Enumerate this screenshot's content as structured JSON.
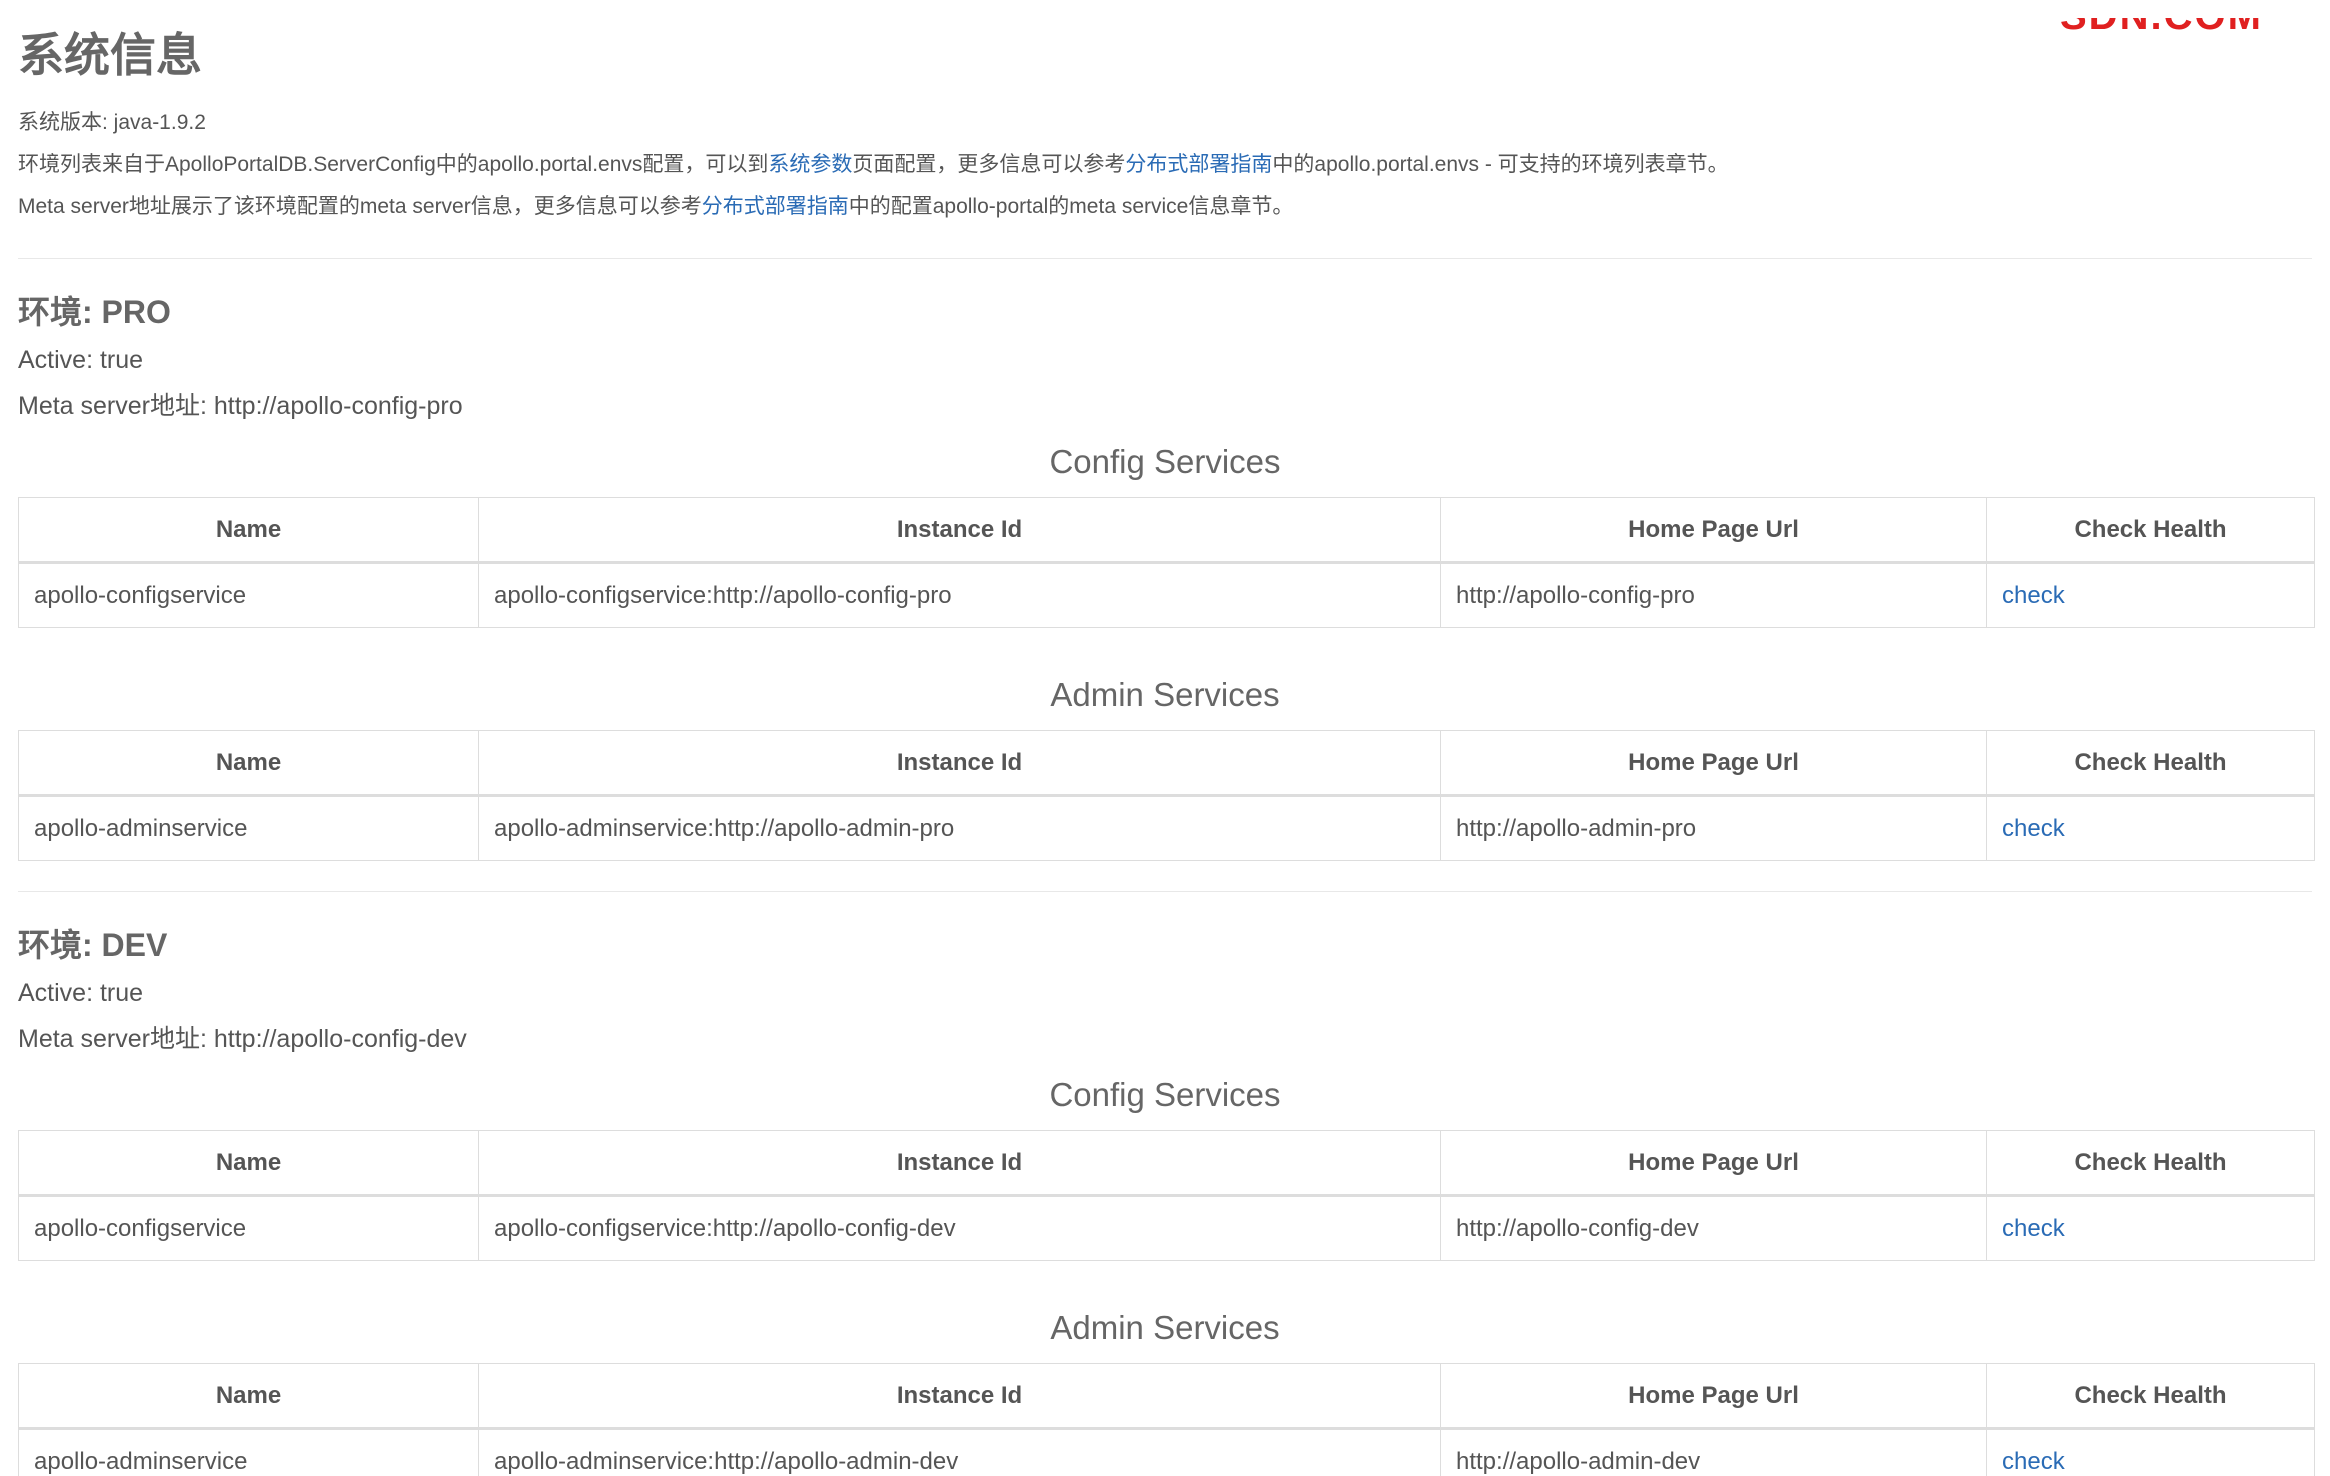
{
  "page": {
    "title": "系统信息",
    "version": "系统版本: java-1.9.2",
    "info1": {
      "part1": "环境列表来自于ApolloPortalDB.ServerConfig中的apollo.portal.envs配置，可以到",
      "link1": "系统参数",
      "part2": "页面配置，更多信息可以参考",
      "link2": "分布式部署指南",
      "part3": "中的apollo.portal.envs - 可支持的环境列表章节。"
    },
    "info2": {
      "part1": "Meta server地址展示了该环境配置的meta server信息，更多信息可以参考",
      "link1": "分布式部署指南",
      "part2": "中的配置apollo-portal的meta service信息章节。"
    }
  },
  "watermark": "SDN.COM",
  "table_headers": {
    "name": "Name",
    "instance_id": "Instance Id",
    "home_page_url": "Home Page Url",
    "check_health": "Check Health"
  },
  "envs": [
    {
      "title": "环境: PRO",
      "active": "Active: true",
      "meta": "Meta server地址: http://apollo-config-pro",
      "config_services": {
        "title": "Config Services",
        "row": {
          "name": "apollo-configservice",
          "instance_id": "apollo-configservice:http://apollo-config-pro",
          "home_page_url": "http://apollo-config-pro",
          "check": "check"
        }
      },
      "admin_services": {
        "title": "Admin Services",
        "row": {
          "name": "apollo-adminservice",
          "instance_id": "apollo-adminservice:http://apollo-admin-pro",
          "home_page_url": "http://apollo-admin-pro",
          "check": "check"
        }
      }
    },
    {
      "title": "环境: DEV",
      "active": "Active: true",
      "meta": "Meta server地址: http://apollo-config-dev",
      "config_services": {
        "title": "Config Services",
        "row": {
          "name": "apollo-configservice",
          "instance_id": "apollo-configservice:http://apollo-config-dev",
          "home_page_url": "http://apollo-config-dev",
          "check": "check"
        }
      },
      "admin_services": {
        "title": "Admin Services",
        "row": {
          "name": "apollo-adminservice",
          "instance_id": "apollo-adminservice:http://apollo-admin-dev",
          "home_page_url": "http://apollo-admin-dev",
          "check": "check"
        }
      }
    }
  ]
}
